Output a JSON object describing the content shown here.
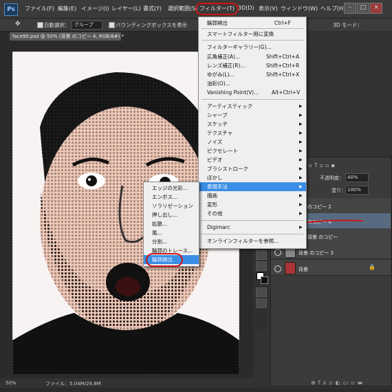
{
  "app": {
    "logo": "Ps"
  },
  "menubar": {
    "items": [
      "ファイル(F)",
      "編集(E)",
      "イメージ(I)",
      "レイヤー(L)",
      "書式(Y)",
      "選択範囲(S)",
      "フィルター(T)",
      "3D(D)",
      "表示(V)",
      "ウィンドウ(W)",
      "ヘルプ(H)"
    ],
    "window_controls": [
      "-",
      "□",
      "×"
    ]
  },
  "options": {
    "auto_select_label": "自動選択：",
    "auto_select_value": "グループ",
    "bounding_box_label": "バウンディングボックスを表示",
    "mode_label": "3D モード："
  },
  "document": {
    "tab_title": "face90.psd @ 50% (背景 のコピー 4, RGB/8#) *",
    "zoom": "50%",
    "file_info": "ファイル：5.04M/29.8M"
  },
  "filter_menu": {
    "items": [
      {
        "label": "輪郭検出",
        "shortcut": "Ctrl+F"
      },
      {
        "label": "スマートフィルター用に変換",
        "shortcut": ""
      },
      {
        "label": "フィルターギャラリー(G)...",
        "shortcut": ""
      },
      {
        "label": "広角補正(A)...",
        "shortcut": "Shift+Ctrl+A"
      },
      {
        "label": "レンズ補正(R)...",
        "shortcut": "Shift+Ctrl+R"
      },
      {
        "label": "ゆがみ(L)...",
        "shortcut": "Shift+Ctrl+X"
      },
      {
        "label": "油彩(O)...",
        "shortcut": ""
      },
      {
        "label": "Vanishing Point(V)...",
        "shortcut": "Alt+Ctrl+V"
      },
      {
        "label": "アーティスティック",
        "shortcut": ""
      },
      {
        "label": "シャープ",
        "shortcut": ""
      },
      {
        "label": "スケッチ",
        "shortcut": ""
      },
      {
        "label": "テクスチャ",
        "shortcut": ""
      },
      {
        "label": "ノイズ",
        "shortcut": ""
      },
      {
        "label": "ピクセレート",
        "shortcut": ""
      },
      {
        "label": "ビデオ",
        "shortcut": ""
      },
      {
        "label": "ブラシストローク",
        "shortcut": ""
      },
      {
        "label": "ぼかし",
        "shortcut": ""
      },
      {
        "label": "表現手法",
        "shortcut": ""
      },
      {
        "label": "描画",
        "shortcut": ""
      },
      {
        "label": "変形",
        "shortcut": ""
      },
      {
        "label": "その他",
        "shortcut": ""
      },
      {
        "label": "Digimarc",
        "shortcut": ""
      },
      {
        "label": "オンラインフィルターを参照...",
        "shortcut": ""
      }
    ]
  },
  "stylize_submenu": {
    "items": [
      "エッジの光彩...",
      "エンボス...",
      "ソラリゼーション",
      "押し出し...",
      "拡散...",
      "風...",
      "分割...",
      "輪郭のトレース...",
      "輪郭検出"
    ]
  },
  "layers": {
    "opacity_label": "不透明度：",
    "opacity_value": "40%",
    "fill_label": "塗り：",
    "fill_value": "100%",
    "rows": [
      "のコピー 2",
      "のコピー 4",
      "背景 のコピー",
      "背景 のコピー 3",
      "背景"
    ]
  },
  "colors": {
    "accent": "#3a8ee6",
    "annotation": "#d01414",
    "panel": "#323232"
  }
}
